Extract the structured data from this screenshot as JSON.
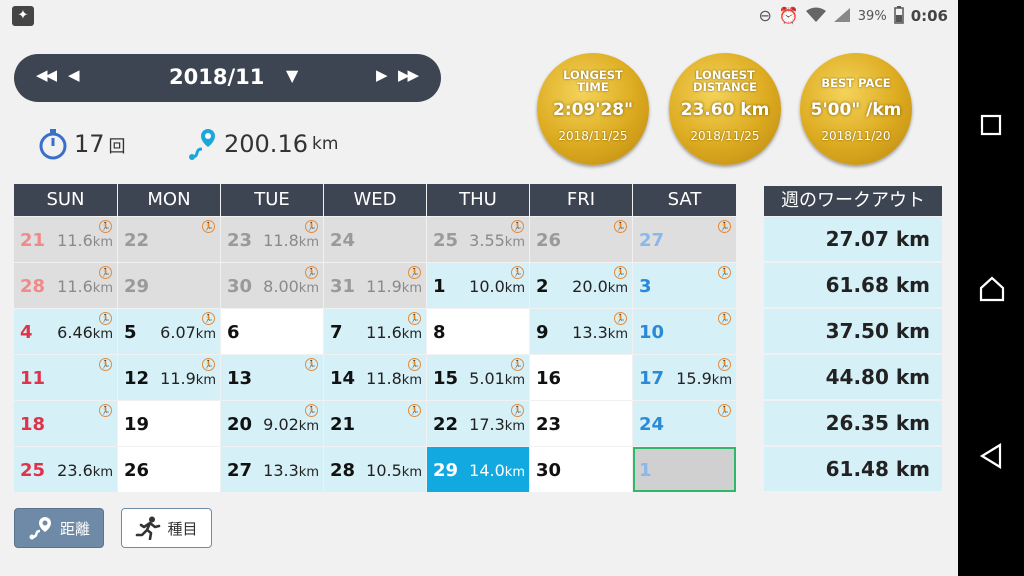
{
  "status": {
    "battery": "39%",
    "time": "0:06"
  },
  "month": {
    "label": "2018/11",
    "prev_prev": "◀◀",
    "prev": "◀",
    "next": "▶",
    "next_next": "▶▶",
    "dropdown": "▼"
  },
  "stats": {
    "count": "17",
    "count_unit": "回",
    "distance": "200.16",
    "distance_unit": "km"
  },
  "medals": [
    {
      "title_l1": "LONGEST",
      "title_l2": "TIME",
      "value": "2:09'28\"",
      "date": "2018/11/25"
    },
    {
      "title_l1": "LONGEST",
      "title_l2": "DISTANCE",
      "value": "23.60 km",
      "date": "2018/11/25"
    },
    {
      "title_l1": "BEST PACE",
      "title_l2": "",
      "value": "5'00\" /km",
      "date": "2018/11/20"
    }
  ],
  "weekdays": [
    "SUN",
    "MON",
    "TUE",
    "WED",
    "THU",
    "FRI",
    "SAT"
  ],
  "weeks": [
    [
      {
        "day": "21",
        "val": "11.6",
        "unit": "km",
        "style": "gray",
        "color": "#f08a8a",
        "run": true
      },
      {
        "day": "22",
        "val": "",
        "unit": "",
        "style": "gray",
        "color": "#9a9a9a",
        "run": true
      },
      {
        "day": "23",
        "val": "11.8",
        "unit": "km",
        "style": "gray",
        "color": "#9a9a9a",
        "run": true
      },
      {
        "day": "24",
        "val": "",
        "unit": "",
        "style": "gray",
        "color": "#9a9a9a",
        "run": false
      },
      {
        "day": "25",
        "val": "3.55",
        "unit": "km",
        "style": "gray",
        "color": "#9a9a9a",
        "run": true
      },
      {
        "day": "26",
        "val": "",
        "unit": "",
        "style": "gray",
        "color": "#9a9a9a",
        "run": true
      },
      {
        "day": "27",
        "val": "",
        "unit": "",
        "style": "gray",
        "color": "#8ab8e8",
        "run": true
      }
    ],
    [
      {
        "day": "28",
        "val": "11.6",
        "unit": "km",
        "style": "gray",
        "color": "#f08a8a",
        "run": true
      },
      {
        "day": "29",
        "val": "",
        "unit": "",
        "style": "gray",
        "color": "#9a9a9a",
        "run": false
      },
      {
        "day": "30",
        "val": "8.00",
        "unit": "km",
        "style": "gray",
        "color": "#9a9a9a",
        "run": true
      },
      {
        "day": "31",
        "val": "11.9",
        "unit": "km",
        "style": "gray",
        "color": "#9a9a9a",
        "run": true
      },
      {
        "day": "1",
        "val": "10.0",
        "unit": "km",
        "style": "blue",
        "color": "#111111",
        "run": true
      },
      {
        "day": "2",
        "val": "20.0",
        "unit": "km",
        "style": "blue",
        "color": "#111111",
        "run": true
      },
      {
        "day": "3",
        "val": "",
        "unit": "",
        "style": "blue",
        "color": "#2a8ad8",
        "run": true
      }
    ],
    [
      {
        "day": "4",
        "val": "6.46",
        "unit": "km",
        "style": "blue",
        "color": "#e0324a",
        "run": true
      },
      {
        "day": "5",
        "val": "6.07",
        "unit": "km",
        "style": "blue",
        "color": "#111111",
        "run": true
      },
      {
        "day": "6",
        "val": "",
        "unit": "",
        "style": "white",
        "color": "#111111",
        "run": false
      },
      {
        "day": "7",
        "val": "11.6",
        "unit": "km",
        "style": "blue",
        "color": "#111111",
        "run": true
      },
      {
        "day": "8",
        "val": "",
        "unit": "",
        "style": "white",
        "color": "#111111",
        "run": false
      },
      {
        "day": "9",
        "val": "13.3",
        "unit": "km",
        "style": "blue",
        "color": "#111111",
        "run": true
      },
      {
        "day": "10",
        "val": "",
        "unit": "",
        "style": "blue",
        "color": "#2a8ad8",
        "run": true
      }
    ],
    [
      {
        "day": "11",
        "val": "",
        "unit": "",
        "style": "blue",
        "color": "#e0324a",
        "run": true
      },
      {
        "day": "12",
        "val": "11.9",
        "unit": "km",
        "style": "blue",
        "color": "#111111",
        "run": true
      },
      {
        "day": "13",
        "val": "",
        "unit": "",
        "style": "blue",
        "color": "#111111",
        "run": true
      },
      {
        "day": "14",
        "val": "11.8",
        "unit": "km",
        "style": "blue",
        "color": "#111111",
        "run": true
      },
      {
        "day": "15",
        "val": "5.01",
        "unit": "km",
        "style": "blue",
        "color": "#111111",
        "run": true
      },
      {
        "day": "16",
        "val": "",
        "unit": "",
        "style": "white",
        "color": "#111111",
        "run": false
      },
      {
        "day": "17",
        "val": "15.9",
        "unit": "km",
        "style": "blue",
        "color": "#2a8ad8",
        "run": true
      }
    ],
    [
      {
        "day": "18",
        "val": "",
        "unit": "",
        "style": "blue",
        "color": "#e0324a",
        "run": true
      },
      {
        "day": "19",
        "val": "",
        "unit": "",
        "style": "white",
        "color": "#111111",
        "run": false
      },
      {
        "day": "20",
        "val": "9.02",
        "unit": "km",
        "style": "blue",
        "color": "#111111",
        "run": true
      },
      {
        "day": "21",
        "val": "",
        "unit": "",
        "style": "blue",
        "color": "#111111",
        "run": true
      },
      {
        "day": "22",
        "val": "17.3",
        "unit": "km",
        "style": "blue",
        "color": "#111111",
        "run": true
      },
      {
        "day": "23",
        "val": "",
        "unit": "",
        "style": "white",
        "color": "#111111",
        "run": false
      },
      {
        "day": "24",
        "val": "",
        "unit": "",
        "style": "blue",
        "color": "#2a8ad8",
        "run": true
      }
    ],
    [
      {
        "day": "25",
        "val": "23.6",
        "unit": "km",
        "style": "blue",
        "color": "#e0324a",
        "run": false
      },
      {
        "day": "26",
        "val": "",
        "unit": "",
        "style": "white",
        "color": "#111111",
        "run": false
      },
      {
        "day": "27",
        "val": "13.3",
        "unit": "km",
        "style": "blue",
        "color": "#111111",
        "run": false
      },
      {
        "day": "28",
        "val": "10.5",
        "unit": "km",
        "style": "blue",
        "color": "#111111",
        "run": false
      },
      {
        "day": "29",
        "val": "14.0",
        "unit": "km",
        "style": "sel",
        "color": "#ffffff",
        "run": false
      },
      {
        "day": "30",
        "val": "",
        "unit": "",
        "style": "white",
        "color": "#111111",
        "run": false
      },
      {
        "day": "1",
        "val": "",
        "unit": "",
        "style": "next",
        "color": "#8ab8e8",
        "run": false
      }
    ]
  ],
  "weekly": {
    "header": "週のワークアウト",
    "totals": [
      "27.07 km",
      "61.68 km",
      "37.50 km",
      "44.80 km",
      "26.35 km",
      "61.48 km"
    ]
  },
  "buttons": {
    "distance": "距離",
    "type": "種目"
  },
  "colors": {
    "header": "#3e4552",
    "blue_cell": "#d6f0f8",
    "selected": "#12a9e0",
    "gold": "#dcaa1f"
  }
}
